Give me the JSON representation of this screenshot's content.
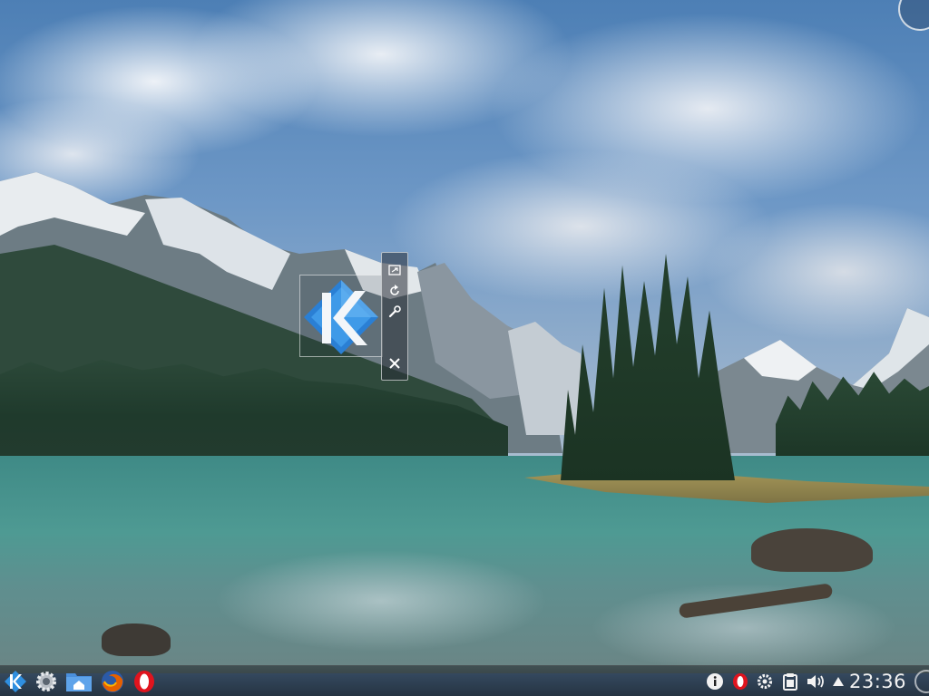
{
  "desktop": {
    "wallpaper": "mountain-lake-landscape",
    "widget": {
      "icon": "kde-logo",
      "actions": [
        {
          "name": "resize-icon"
        },
        {
          "name": "rotate-icon"
        },
        {
          "name": "configure-icon"
        },
        {
          "name": "close-icon"
        }
      ]
    },
    "corner_toolbox": {
      "icon": "desktop-toolbox-icon"
    }
  },
  "panel": {
    "launchers": [
      {
        "name": "kde-application-launcher",
        "icon": "kde-logo-icon",
        "color": "#2f8fe0"
      },
      {
        "name": "system-settings-launcher",
        "icon": "gear-icon",
        "color": "#c9cdd2"
      },
      {
        "name": "home-folder-launcher",
        "icon": "home-folder-icon",
        "color": "#4a8fdc"
      },
      {
        "name": "firefox-launcher",
        "icon": "firefox-icon",
        "color": "#e66000"
      },
      {
        "name": "opera-launcher",
        "icon": "opera-icon",
        "color": "#e0141e"
      }
    ],
    "tray": [
      {
        "name": "info-icon"
      },
      {
        "name": "opera-tray-icon",
        "color": "#e0141e"
      },
      {
        "name": "settings-tray-icon"
      },
      {
        "name": "clipboard-icon"
      },
      {
        "name": "volume-icon"
      },
      {
        "name": "expand-tray-icon"
      }
    ],
    "clock": "23:36"
  }
}
